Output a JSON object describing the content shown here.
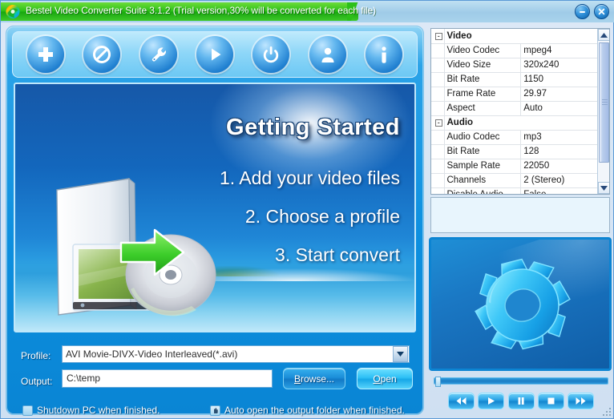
{
  "window": {
    "title": "Bestel Video Converter Suite 3.1.2 (Trial version,30% will be converted for each file)",
    "minimize_label": "Minimize",
    "close_label": "Close",
    "logo_icon": "rainbow-swirl-logo"
  },
  "toolbar": {
    "buttons": [
      {
        "name": "add-files-button",
        "icon": "plus-icon",
        "tooltip": "Add"
      },
      {
        "name": "remove-files-button",
        "icon": "no-entry-icon",
        "tooltip": "Remove"
      },
      {
        "name": "settings-button",
        "icon": "wrench-icon",
        "tooltip": "Settings"
      },
      {
        "name": "play-button",
        "icon": "play-icon",
        "tooltip": "Play"
      },
      {
        "name": "convert-button",
        "icon": "power-icon",
        "tooltip": "Convert"
      },
      {
        "name": "account-button",
        "icon": "person-icon",
        "tooltip": "Register"
      },
      {
        "name": "about-button",
        "icon": "info-icon",
        "tooltip": "About"
      }
    ]
  },
  "splash": {
    "title": "Getting Started",
    "steps": [
      "1. Add your video files",
      "2. Choose a profile",
      "3. Start convert"
    ],
    "art_icon": "door-arrow-disc-illustration"
  },
  "profile": {
    "label": "Profile:",
    "value": "AVI Movie-DIVX-Video Interleaved(*.avi)",
    "dropdown_icon": "chevron-down-icon"
  },
  "output": {
    "label": "Output:",
    "value": "C:\\temp",
    "placeholder": "C:\\temp",
    "browse_label": "Browse...",
    "browse_accel": "B",
    "open_label": "Open",
    "open_accel": "O"
  },
  "options": {
    "shutdown": {
      "label": "Shutdown PC when finished.",
      "checked": false
    },
    "auto_open": {
      "label": "Auto open the output folder when finished.",
      "checked": true,
      "icon": "hand-cursor-icon"
    }
  },
  "properties": {
    "groups": [
      {
        "name": "Video",
        "expanded": true,
        "rows": [
          {
            "key": "Video Codec",
            "value": "mpeg4"
          },
          {
            "key": "Video Size",
            "value": "320x240"
          },
          {
            "key": "Bit Rate",
            "value": "1150"
          },
          {
            "key": "Frame Rate",
            "value": "29.97"
          },
          {
            "key": "Aspect",
            "value": "Auto"
          }
        ]
      },
      {
        "name": "Audio",
        "expanded": true,
        "rows": [
          {
            "key": "Audio Codec",
            "value": "mp3"
          },
          {
            "key": "Bit Rate",
            "value": "128"
          },
          {
            "key": "Sample Rate",
            "value": "22050"
          },
          {
            "key": "Channels",
            "value": "2 (Stereo)"
          },
          {
            "key": "Disable Audio",
            "value": "False"
          }
        ]
      }
    ],
    "expander_collapse_glyph": "-",
    "scrollbar": {
      "up_icon": "chevron-up-icon",
      "down_icon": "chevron-down-icon"
    }
  },
  "preview": {
    "placeholder_icon": "gear-logo-icon"
  },
  "media": {
    "seek_value": 0,
    "buttons": [
      {
        "name": "rewind-button",
        "icon": "rewind-icon"
      },
      {
        "name": "play-button",
        "icon": "play-icon"
      },
      {
        "name": "pause-button",
        "icon": "pause-icon"
      },
      {
        "name": "stop-button",
        "icon": "stop-icon"
      },
      {
        "name": "forward-button",
        "icon": "fast-forward-icon"
      }
    ]
  },
  "colors": {
    "title_green": "#2bbf18",
    "panel_blue": "#0d8fdf",
    "accent_cyan": "#2ec0f6",
    "grid_value_gray": "#8d8d8d"
  }
}
